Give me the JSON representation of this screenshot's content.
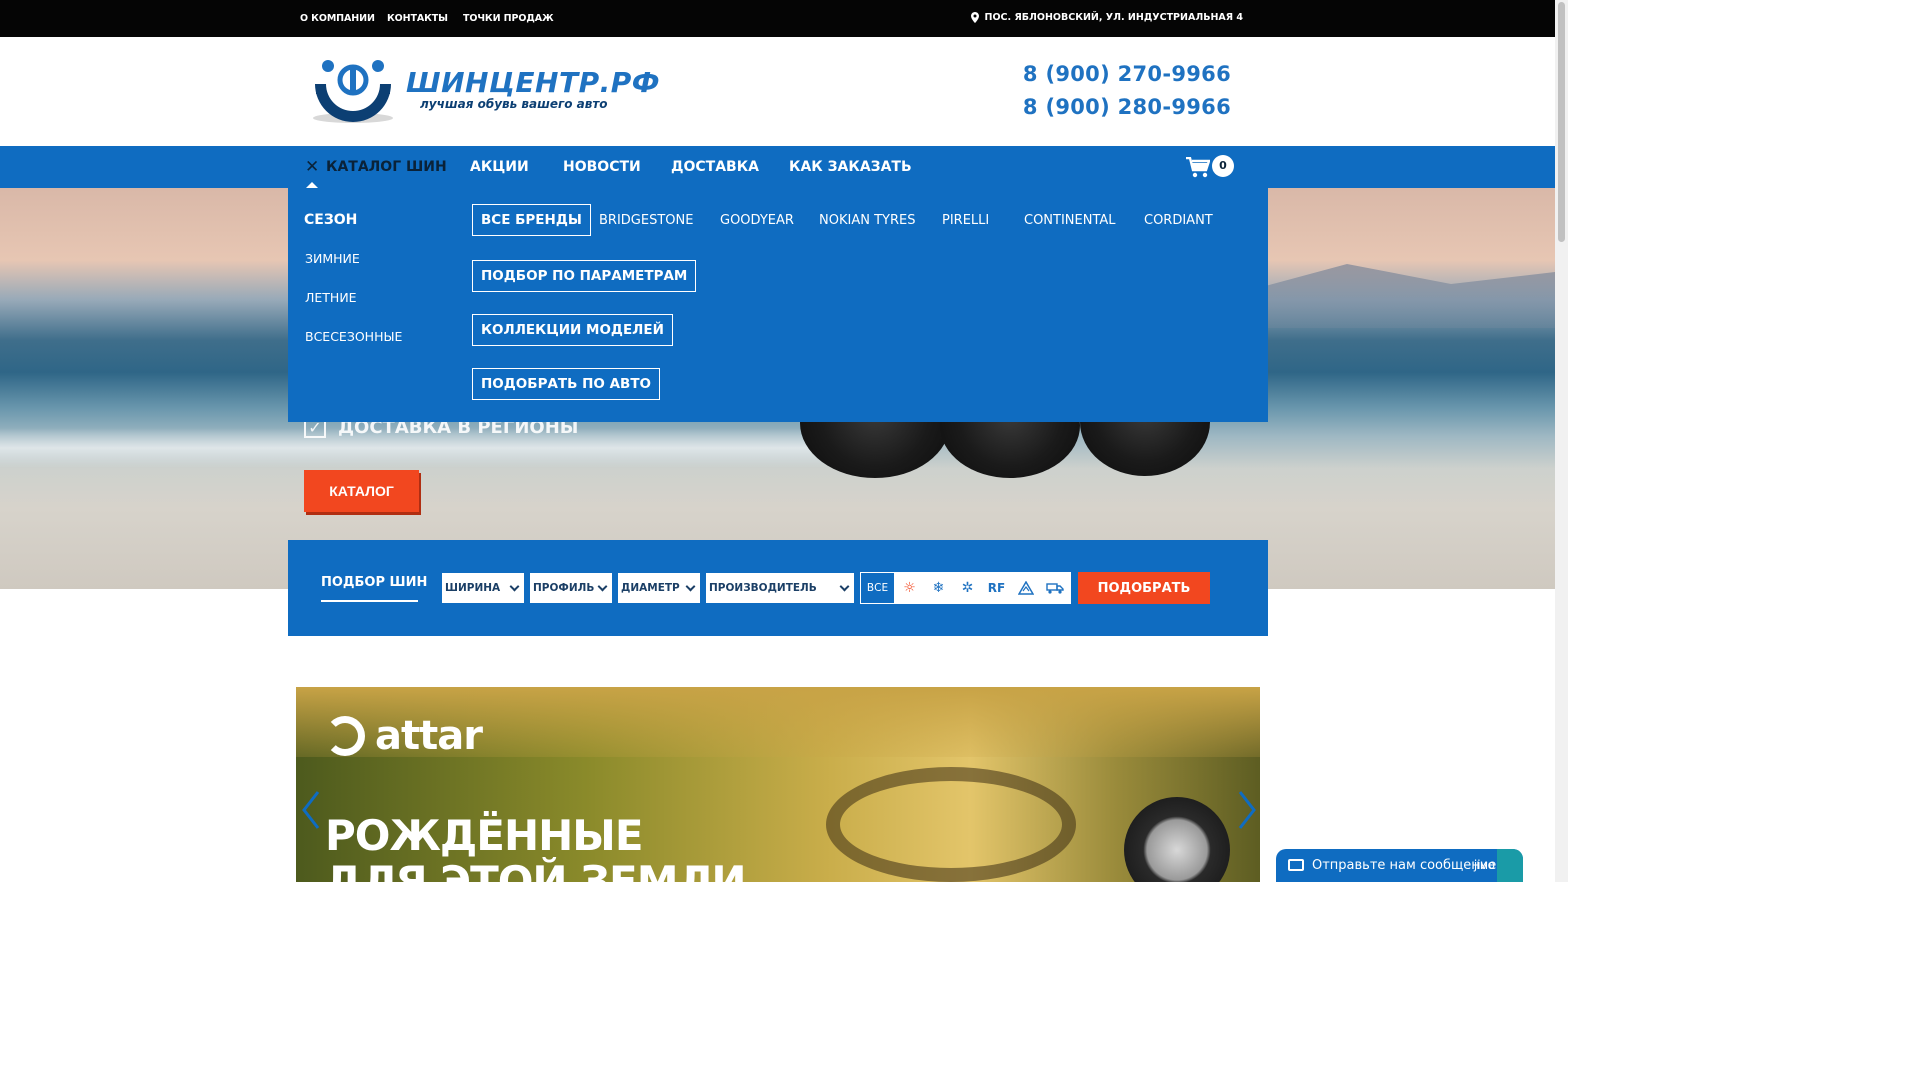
{
  "topbar": {
    "links": [
      "О КОМПАНИИ",
      "КОНТАКТЫ",
      "ТОЧКИ ПРОДАЖ"
    ],
    "address": "ПОС. ЯБЛОНОВСКИЙ, УЛ. ИНДУСТРИАЛЬНАЯ 4"
  },
  "header": {
    "logo_title": "ШИНЦЕНТР.РФ",
    "logo_subtitle": "лучшая обувь вашего авто",
    "phones": [
      "8 (900) 270-9966",
      "8 (900) 280-9966"
    ]
  },
  "nav": {
    "items": [
      "КАТАЛОГ ШИН",
      "АКЦИИ",
      "НОВОСТИ",
      "ДОСТАВКА",
      "КАК ЗАКАЗАТЬ"
    ],
    "cart_count": "0"
  },
  "dropdown": {
    "season_title": "СЕЗОН",
    "seasons": [
      "ЗИМНИЕ",
      "ЛЕТНИЕ",
      "ВСЕСЕЗОННЫЕ"
    ],
    "buttons": [
      "ВСЕ БРЕНДЫ",
      "ПОДБОР ПО ПАРАМЕТРАМ",
      "КОЛЛЕКЦИИ МОДЕЛЕЙ",
      "ПОДОБРАТЬ ПО АВТО"
    ],
    "brands": [
      "BRIDGESTONE",
      "GOODYEAR",
      "NOKIAN TYRES",
      "PIRELLI",
      "CONTINENTAL",
      "CORDIANT"
    ]
  },
  "hero": {
    "delivery_text": "ДОСТАВКА В РЕГИОНЫ",
    "catalog_button": "КАТАЛОГ"
  },
  "search": {
    "title": "ПОДБОР ШИН",
    "selects": [
      "ШИРИНА",
      "ПРОФИЛЬ",
      "ДИАМЕТР",
      "ПРОИЗВОДИТЕЛЬ"
    ],
    "season_all": "ВСЕ",
    "season_icons": [
      "sun-icon",
      "snowflake-icon",
      "all-season-icon",
      "runflat-icon",
      "offroad-icon",
      "truck-icon"
    ],
    "runflat_label": "RF",
    "submit": "ПОДОБРАТЬ"
  },
  "banner": {
    "brand": "attar",
    "headline": "РОЖДЁННЫЕ",
    "headline_2": "ДЛЯ ЭТОЙ ЗЕМЛИ"
  },
  "chat": {
    "label": "Отправьте нам сообщение",
    "brand": "jivo"
  },
  "colors": {
    "primary_blue": "#0f6cc1",
    "accent_orange": "#f2471f",
    "dark": "#050505"
  }
}
